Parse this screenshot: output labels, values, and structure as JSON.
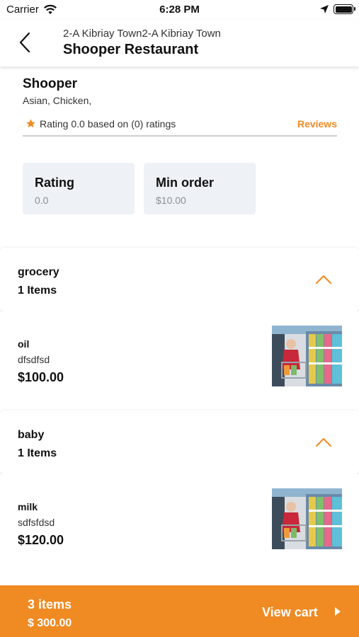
{
  "status_bar": {
    "carrier": "Carrier",
    "time": "6:28 PM",
    "icons": [
      "wifi-icon",
      "location-arrow-icon",
      "battery-icon"
    ]
  },
  "header": {
    "address": "2-A Kibriay Town2-A Kibriay Town",
    "title": "Shooper Restaurant",
    "back_icon": "chevron-left-icon"
  },
  "store": {
    "name": "Shooper",
    "cuisines": "Asian, Chicken,",
    "rating_text": "Rating 0.0 based on (0) ratings",
    "reviews_label": "Reviews",
    "accent_color": "#f08a23"
  },
  "stats": [
    {
      "label": "Rating",
      "value": "0.0"
    },
    {
      "label": "Min order",
      "value": "$10.00"
    }
  ],
  "categories": [
    {
      "name": "grocery",
      "count_label": "1 Items",
      "expanded": true,
      "products": [
        {
          "name": "oil",
          "description": "dfsdfsd",
          "price": "$100.00",
          "image": "supermarket-shopper-photo"
        }
      ]
    },
    {
      "name": "baby",
      "count_label": "1 Items",
      "expanded": true,
      "products": [
        {
          "name": "milk",
          "description": "sdfsfdsd",
          "price": "$120.00",
          "image": "supermarket-shopper-photo"
        }
      ]
    }
  ],
  "cart": {
    "count_label": "3 items",
    "total": "$ 300.00",
    "view_label": "View cart",
    "background_color": "#f08a23"
  }
}
